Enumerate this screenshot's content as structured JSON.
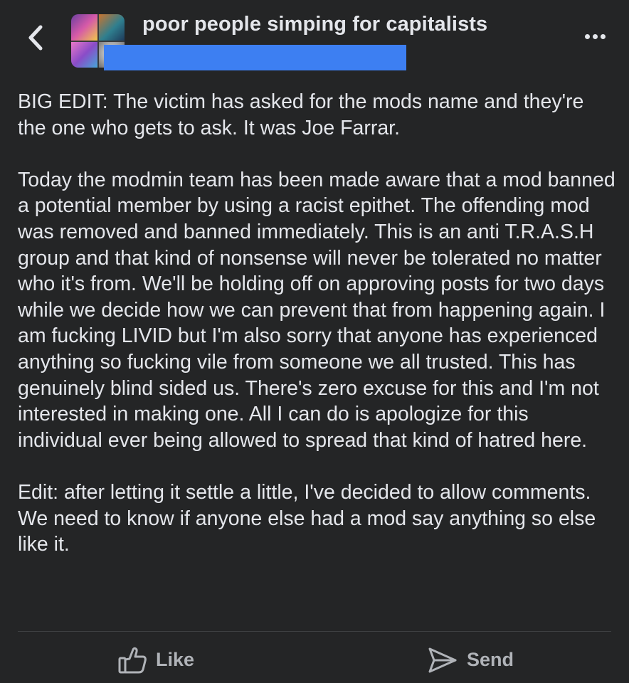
{
  "header": {
    "group_name": "poor people simping for capitalists",
    "back_icon": "chevron-left-icon",
    "more_icon": "more-horizontal-icon",
    "redaction_color": "#3d7ff2"
  },
  "post": {
    "paragraphs": [
      "BIG EDIT: The victim has asked for the mods name and they're the one who gets to ask. It was Joe Farrar.",
      "Today the modmin team has been made aware that a mod banned a potential member by using a racist epithet. The offending mod was removed and banned immediately. This is an anti T.R.A.S.H group and that kind of nonsense will never be tolerated no matter who it's from. We'll be holding off on approving posts for two days while we decide how we can prevent that from happening again. I am fucking LIVID but I'm also sorry that anyone has experienced anything so fucking vile from someone we all trusted. This has genuinely blind sided us. There's zero excuse for this and I'm not interested in making one. All I can do is apologize for this individual ever being allowed to spread that kind of hatred here.",
      "Edit: after letting it settle a little, I've decided to allow comments. We need to know if anyone else had a mod say anything so else like it."
    ]
  },
  "actions": {
    "like_label": "Like",
    "like_icon": "thumbs-up-icon",
    "send_label": "Send",
    "send_icon": "send-icon"
  },
  "colors": {
    "background": "#242526",
    "text": "#e4e6eb",
    "muted": "#b0b3b8",
    "divider": "#3e4042"
  }
}
